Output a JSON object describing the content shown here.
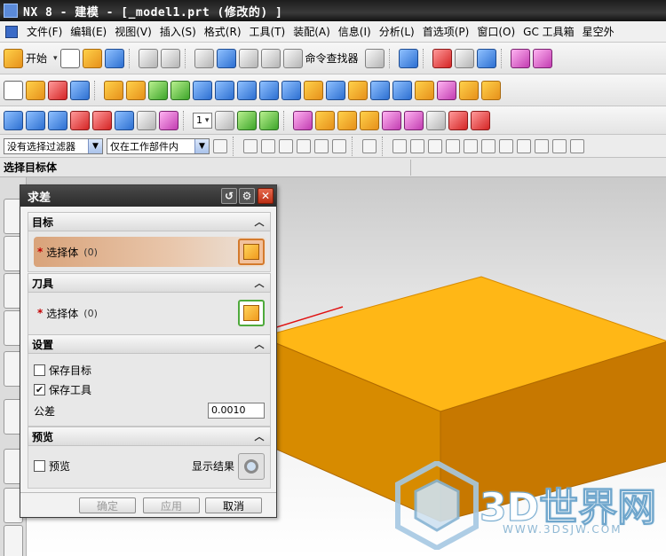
{
  "window": {
    "title": "NX 8 - 建模 - [_model1.prt  (修改的) ]"
  },
  "menubar": {
    "items": [
      "文件(F)",
      "编辑(E)",
      "视图(V)",
      "插入(S)",
      "格式(R)",
      "工具(T)",
      "装配(A)",
      "信息(I)",
      "分析(L)",
      "首选项(P)",
      "窗口(O)",
      "GC 工具箱",
      "星空外"
    ]
  },
  "toolbar": {
    "start_label": "开始",
    "command_finder_label": "命令查找器",
    "layer_value": "1"
  },
  "filterbar": {
    "type_filter": "没有选择过滤器",
    "scope_filter": "仅在工作部件内"
  },
  "cue": {
    "text": "选择目标体"
  },
  "dialog": {
    "title": "求差",
    "target": {
      "header": "目标",
      "required_mark": "*",
      "select_label": "选择体",
      "count": "(0)"
    },
    "tool": {
      "header": "刀具",
      "required_mark": "*",
      "select_label": "选择体",
      "count": "(0)"
    },
    "settings": {
      "header": "设置",
      "keep_target_label": "保存目标",
      "keep_target_checked": false,
      "keep_tool_label": "保存工具",
      "keep_tool_checked": true,
      "tolerance_label": "公差",
      "tolerance_value": "0.0010"
    },
    "preview": {
      "header": "预览",
      "preview_label": "预览",
      "preview_checked": false,
      "show_result_label": "显示结果"
    },
    "buttons": {
      "ok": "确定",
      "apply": "应用",
      "cancel": "取消"
    }
  },
  "watermark": {
    "text": "3D世界网",
    "url": "WWW.3DSJW.COM"
  },
  "colors": {
    "block_top": "#FFB716",
    "block_front": "#D78B00",
    "block_side": "#C77800",
    "annotation_arrow": "#E01010",
    "active_selection": "#D9A37A"
  }
}
